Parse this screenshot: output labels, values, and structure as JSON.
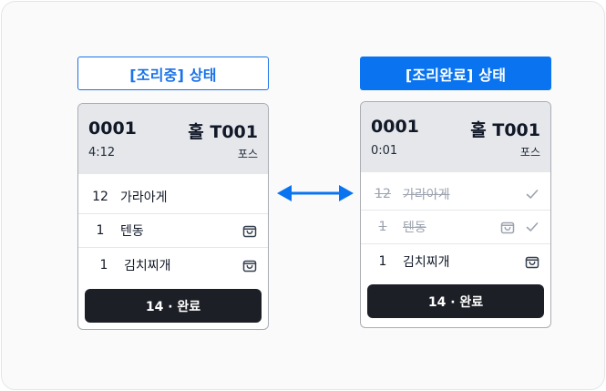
{
  "states": {
    "cooking": {
      "label": "[조리중] 상태",
      "order_no": "0001",
      "table": "홀 T001",
      "elapsed": "4:12",
      "source": "포스",
      "items": [
        {
          "qty": "12",
          "name": "가라아게",
          "bag": false,
          "done": false
        },
        {
          "qty": "1",
          "name": "텐동",
          "bag": true,
          "done": false
        },
        {
          "qty": "1",
          "name": "김치찌개",
          "bag": true,
          "done": false
        }
      ],
      "complete_button": "14 · 완료"
    },
    "completed": {
      "label": "[조리완료] 상태",
      "order_no": "0001",
      "table": "홀 T001",
      "elapsed": "0:01",
      "source": "포스",
      "items": [
        {
          "qty": "12",
          "name": "가라아게",
          "bag": false,
          "done": true
        },
        {
          "qty": "1",
          "name": "텐동",
          "bag": true,
          "done": true
        },
        {
          "qty": "1",
          "name": "김치찌개",
          "bag": true,
          "done": false
        }
      ],
      "complete_button": "14 · 완료"
    }
  },
  "colors": {
    "accent": "#0a74f0",
    "outline_label": "#1a73e8",
    "card_header": "#e5e7eb",
    "button": "#1c1f26",
    "done_text": "#9ca3af"
  },
  "icons": {
    "takeout": "shopping-bag-icon",
    "done": "check-icon",
    "transition": "double-arrow-icon"
  }
}
